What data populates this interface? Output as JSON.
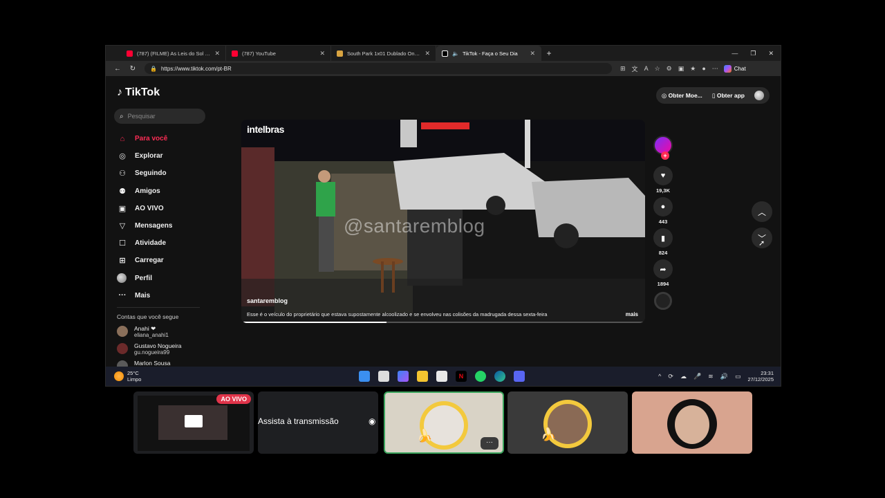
{
  "browser": {
    "tabs": [
      {
        "title": "(787) (FILME) As Leis do Sol [dublado]",
        "favicon_color": "#ff0033"
      },
      {
        "title": "(787) YouTube",
        "favicon_color": "#ff0033"
      },
      {
        "title": "South Park 1x01 Dublado Online",
        "favicon_color": "#d9a441"
      },
      {
        "title": "TikTok - Faça o Seu Dia",
        "favicon_color": "#ffffff"
      }
    ],
    "url": "https://www.tiktok.com/pt-BR",
    "chat_label": "Chat"
  },
  "tiktok": {
    "logo": "TikTok",
    "search_placeholder": "Pesquisar",
    "nav": [
      {
        "label": "Para você",
        "icon": "home-icon"
      },
      {
        "label": "Explorar",
        "icon": "compass-icon"
      },
      {
        "label": "Seguindo",
        "icon": "following-icon"
      },
      {
        "label": "Amigos",
        "icon": "friends-icon"
      },
      {
        "label": "AO VIVO",
        "icon": "live-icon"
      },
      {
        "label": "Mensagens",
        "icon": "messages-icon"
      },
      {
        "label": "Atividade",
        "icon": "activity-icon"
      },
      {
        "label": "Carregar",
        "icon": "upload-icon"
      },
      {
        "label": "Perfil",
        "icon": "avatar"
      },
      {
        "label": "Mais",
        "icon": "more-icon"
      }
    ],
    "following_title": "Contas que você segue",
    "following": [
      {
        "name": "Anahi ❤",
        "user": "eliana_anahi1"
      },
      {
        "name": "Gustavo Nogueira",
        "user": "gu.nogueira99"
      },
      {
        "name": "Marlon Sousa",
        "user": ""
      }
    ],
    "top": {
      "coins": "Obter Moe...",
      "app": "Obter app"
    },
    "video": {
      "brand_watermark": "intelbras",
      "site_watermark": "@santaremblog",
      "author": "santaremblog",
      "caption": "Esse é o veículo do proprietário que estava supostamente alcoolizado e se envolveu nas colisões da madrugada dessa sexta-feira",
      "more": "mais",
      "progress": 0.36
    },
    "stats": {
      "likes": "19,3K",
      "comments": "443",
      "saves": "824",
      "shares": "1894"
    }
  },
  "taskbar": {
    "temp": "25°C",
    "weather": "Limpo",
    "time": "23:31",
    "date": "27/12/2025"
  },
  "tiles": {
    "live_badge": "AO VIVO",
    "watch_text": "Assista à transmissão",
    "more": "···"
  }
}
